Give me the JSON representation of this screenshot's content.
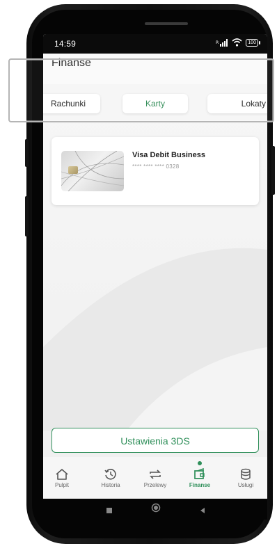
{
  "status_bar": {
    "time": "14:59",
    "battery": "100"
  },
  "header": {
    "title": "Finanse"
  },
  "tabs": [
    {
      "label": "Rachunki",
      "active": false
    },
    {
      "label": "Karty",
      "active": true
    },
    {
      "label": "Lokaty",
      "active": false
    }
  ],
  "card": {
    "name": "Visa Debit Business",
    "number": "**** **** **** 0328"
  },
  "settings_button": {
    "label": "Ustawienia 3DS"
  },
  "bottom_nav": [
    {
      "label": "Pulpit",
      "icon": "home-icon",
      "active": false
    },
    {
      "label": "Historia",
      "icon": "history-icon",
      "active": false
    },
    {
      "label": "Przelewy",
      "icon": "transfer-icon",
      "active": false
    },
    {
      "label": "Finanse",
      "icon": "wallet-icon",
      "active": true
    },
    {
      "label": "Usługi",
      "icon": "database-icon",
      "active": false
    }
  ],
  "colors": {
    "accent": "#2f8f5a",
    "background": "#f2f2f2",
    "callout": "#b5b5b5"
  }
}
